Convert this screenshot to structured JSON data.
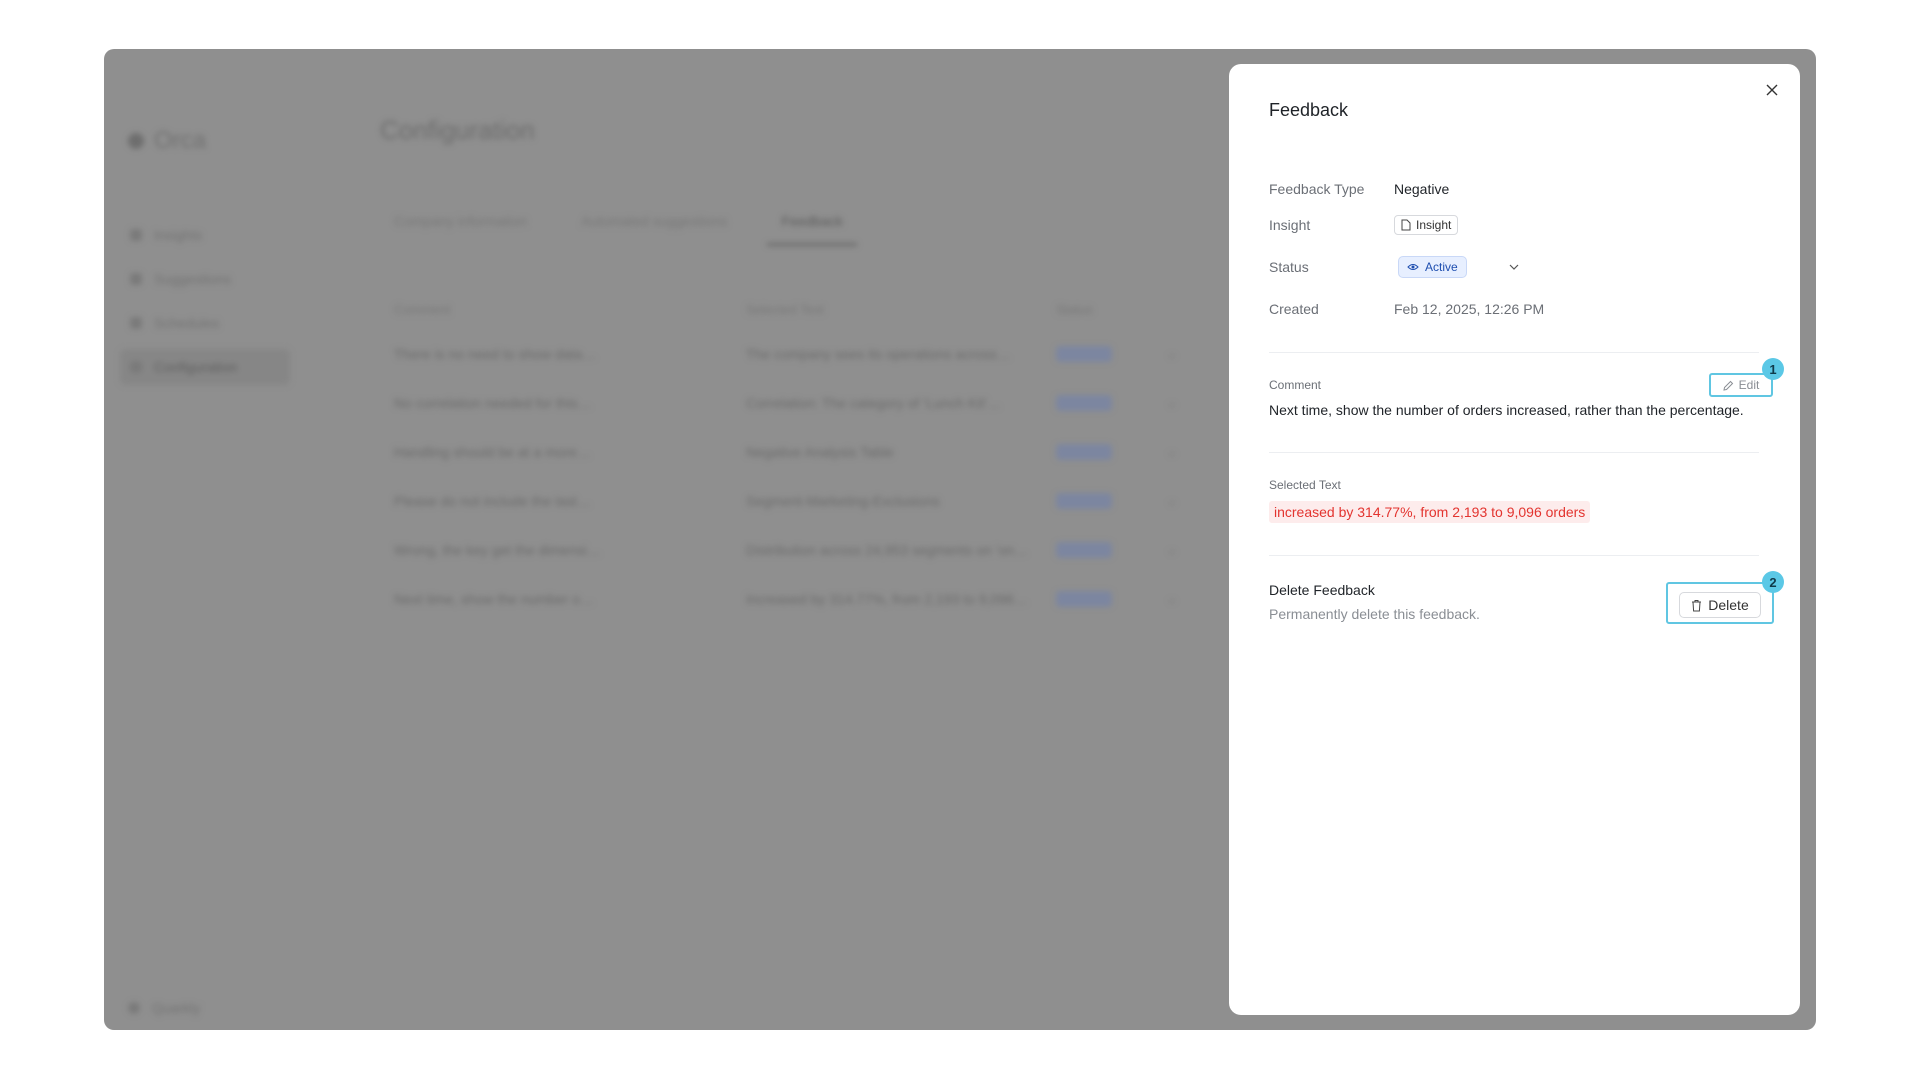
{
  "background": {
    "app_name": "Orca",
    "nav_items": [
      "Insights",
      "Suggestions",
      "Schedules",
      "Configuration"
    ],
    "bottom_item": "Quarkly",
    "page_title": "Configuration",
    "tabs": [
      "Company information",
      "Automated suggestions",
      "Feedback"
    ],
    "table_headers": [
      "Comment",
      "Selected Text",
      "Status"
    ],
    "table_rows": [
      {
        "comment": "There is no need to show data…",
        "selected": "The company sees its operations across…",
        "status": "Active"
      },
      {
        "comment": "No correlation needed for this…",
        "selected": "Correlation: The category of 'Lunch Kit'…",
        "status": "Active"
      },
      {
        "comment": "Handling should be at a more…",
        "selected": "Negative Analysis Table",
        "status": "Active"
      },
      {
        "comment": "Please do not include the last…",
        "selected": "Segment-Marketing-Exclusions",
        "status": "Active"
      },
      {
        "comment": "Wrong, the key get the dimensi…",
        "selected": "Distribution across 24,953 segments on 'on…",
        "status": "Active"
      },
      {
        "comment": "Next time, show the number o…",
        "selected": "increased by 314.77%, from 2,193 to 9,096…",
        "status": "Active"
      }
    ]
  },
  "panel": {
    "title": "Feedback",
    "close_icon": "×",
    "feedback_type_label": "Feedback Type",
    "feedback_type_value": "Negative",
    "insight_label": "Insight",
    "insight_chip": "Insight",
    "status_label": "Status",
    "status_value": "Active",
    "created_label": "Created",
    "created_value": "Feb 12, 2025, 12:26 PM",
    "comment_label": "Comment",
    "edit_label": "Edit",
    "comment_text": "Next time, show the number of orders increased, rather than the percentage.",
    "selected_text_label": "Selected Text",
    "selected_text": "increased by 314.77%, from 2,193 to 9,096 orders",
    "delete_title": "Delete Feedback",
    "delete_subtitle": "Permanently delete this feedback.",
    "delete_label": "Delete"
  },
  "annotations": {
    "badge_1": "1",
    "badge_2": "2"
  },
  "colors": {
    "overlay": "#8f8f8f",
    "status_bg": "#e7efff",
    "status_text": "#1f4fb0",
    "highlight_bg": "#fdecec",
    "highlight_text": "#e3342f",
    "annotation": "#5bc8e6"
  }
}
